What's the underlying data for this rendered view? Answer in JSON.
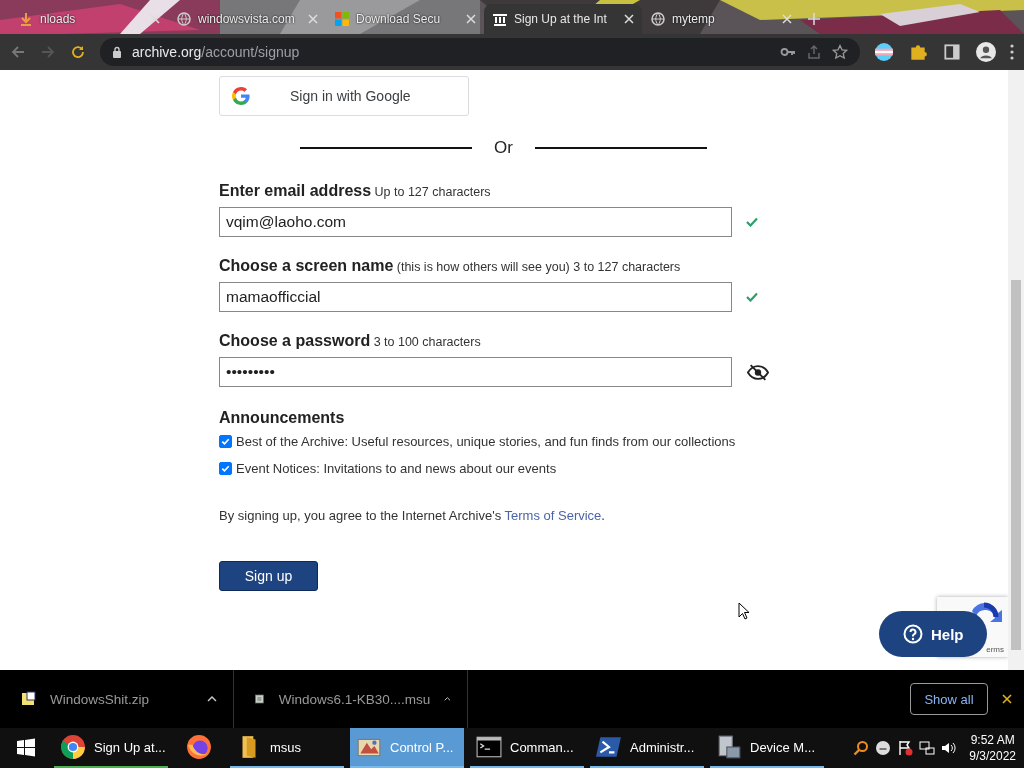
{
  "browser": {
    "tabs": [
      {
        "title": "nloads",
        "selected": false,
        "kind": "download"
      },
      {
        "title": "windowsvista.com",
        "selected": false,
        "kind": "globe"
      },
      {
        "title": "Download Secu",
        "selected": false,
        "kind": "windows"
      },
      {
        "title": "Sign Up at the Int",
        "selected": true,
        "kind": "archive"
      },
      {
        "title": "mytemp",
        "selected": false,
        "kind": "globe"
      }
    ],
    "url_host": "archive.org",
    "url_path": "/account/signup"
  },
  "form": {
    "google_button": "Sign in with Google",
    "divider": "Or",
    "fields": [
      {
        "label": "Enter email address",
        "hint": "Up to 127 characters",
        "value": "vqim@laoho.com",
        "kind": "valid"
      },
      {
        "label": "Choose a screen name",
        "hint": "(this is how others will see you) 3 to 127 characters",
        "value": "mamaofficcial",
        "kind": "valid"
      },
      {
        "label": "Choose a password",
        "hint": "3 to 100 characters",
        "value": "•••••••••",
        "kind": "password"
      }
    ],
    "announcements_title": "Announcements",
    "announcements": [
      {
        "label": "Best of the Archive: Useful resources, unique stories, and fun finds from our collections",
        "checked": true
      },
      {
        "label": "Event Notices: Invitations to and news about our events",
        "checked": true
      }
    ],
    "terms_text": "By signing up, you agree to the Internet Archive's ",
    "terms_link": "Terms of Service",
    "terms_end": ".",
    "submit": "Sign up",
    "help": "Help",
    "recaptcha_text": "erms"
  },
  "downloads": {
    "items": [
      {
        "name": "WindowsShit.zip",
        "kind": "zip"
      },
      {
        "name": "Windows6.1-KB30....msu",
        "kind": "msu"
      }
    ],
    "show_all": "Show all"
  },
  "taskbar": {
    "items": [
      {
        "label": "Sign Up at...",
        "kind": "chrome",
        "selected": false
      },
      {
        "kind": "firefox",
        "selected": false
      },
      {
        "label": "msus",
        "kind": "folder",
        "selected": false
      },
      {
        "label": "Control P...",
        "kind": "control",
        "selected": true
      },
      {
        "label": "Comman...",
        "kind": "cmd",
        "selected": false
      },
      {
        "label": "Administr...",
        "kind": "powershell",
        "selected": false
      },
      {
        "label": "Device M...",
        "kind": "device",
        "selected": false
      }
    ],
    "time": "9:52 AM",
    "date": "9/3/2022"
  }
}
